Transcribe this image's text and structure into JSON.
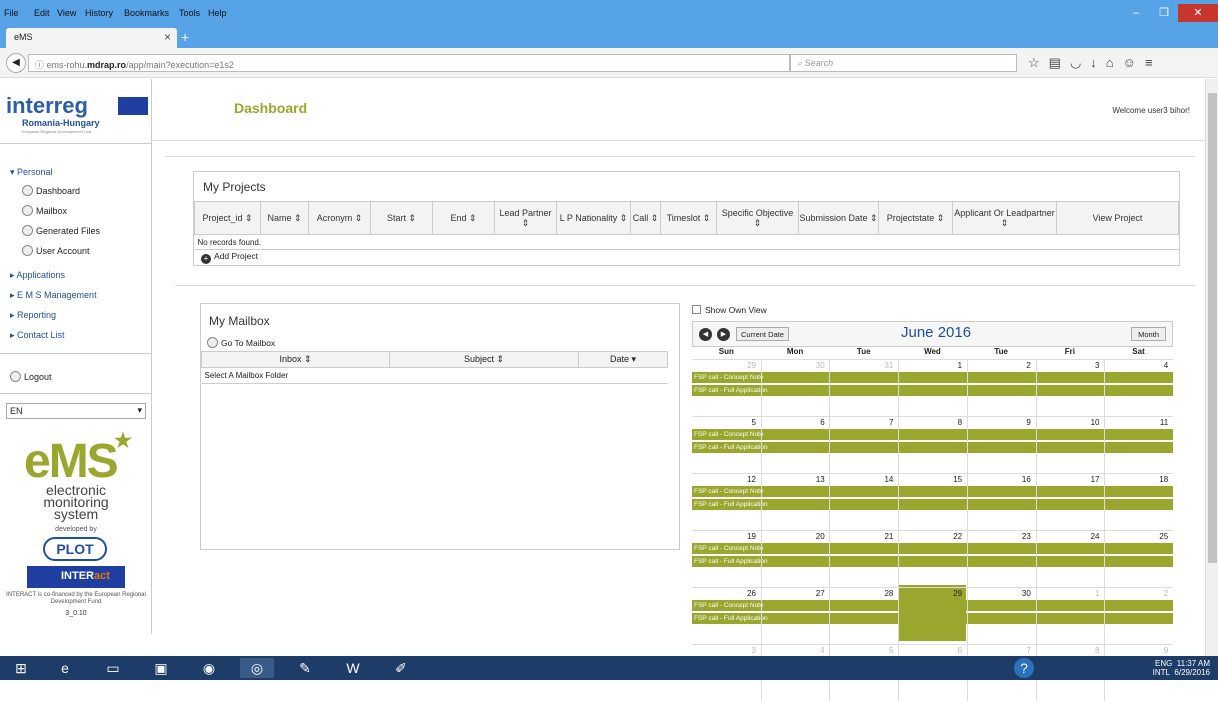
{
  "browser": {
    "menu": [
      "File",
      "Edit",
      "View",
      "History",
      "Bookmarks",
      "Tools",
      "Help"
    ],
    "tab_title": "eMS",
    "url_prefix": "ems-rohu.",
    "url_domain": "mdrap.ro",
    "url_path": "/app/main?execution=e1s2",
    "search_placeholder": "Search"
  },
  "sidebar": {
    "brand": "interreg",
    "brand_sub": "Romania-Hungary",
    "brand_sub2": "European Regional Development Fund",
    "personal": "Personal",
    "personal_items": [
      "Dashboard",
      "Mailbox",
      "Generated Files",
      "User Account"
    ],
    "sections": [
      "Applications",
      "E M S Management",
      "Reporting",
      "Contact List"
    ],
    "logout": "Logout",
    "language": "EN",
    "ems_logo": "eMS",
    "ems_lines": [
      "electronic",
      "monitoring",
      "system"
    ],
    "developed_by": "developed by",
    "plot": "PLOT",
    "interact_a": "INTER",
    "interact_b": "act",
    "cofinanced": "INTERACT is co-financed by the European Regional Development Fund",
    "version": "3_0.10"
  },
  "header": {
    "title": "Dashboard",
    "welcome": "Welcome user3 bihor!"
  },
  "projects": {
    "title": "My Projects",
    "columns": [
      "Project_id ⇕",
      "Name ⇕",
      "Acronym ⇕",
      "Start ⇕",
      "End ⇕",
      "Lead Partner ⇕",
      "L P Nationality ⇕",
      "Call ⇕",
      "Timeslot ⇕",
      "Specific Objective ⇕",
      "Submission Date ⇕",
      "Projectstate ⇕",
      "Applicant Or Leadpartner ⇕",
      "View Project"
    ],
    "empty": "No records found.",
    "add": "Add Project"
  },
  "mailbox": {
    "title": "My Mailbox",
    "goto": "Go To Mailbox",
    "columns": [
      "Inbox ⇕",
      "Subject ⇕",
      "Date ▾"
    ],
    "row": "Select A Mailbox Folder"
  },
  "calendar": {
    "own_view": "Show Own View",
    "current_date": "Current Date",
    "title": "June 2016",
    "month_button": "Month",
    "dow": [
      "Sun",
      "Mon",
      "Tue",
      "Wed",
      "Tue",
      "Fri",
      "Sat"
    ],
    "weeks": [
      [
        "29",
        "30",
        "31",
        "1",
        "2",
        "3",
        "4"
      ],
      [
        "5",
        "6",
        "7",
        "8",
        "9",
        "10",
        "11"
      ],
      [
        "12",
        "13",
        "14",
        "15",
        "16",
        "17",
        "18"
      ],
      [
        "19",
        "20",
        "21",
        "22",
        "23",
        "24",
        "25"
      ],
      [
        "26",
        "27",
        "28",
        "29",
        "30",
        "1",
        "2"
      ],
      [
        "3",
        "4",
        "5",
        "6",
        "7",
        "8",
        "9"
      ]
    ],
    "event_a": "FSP call - Concept Note",
    "event_b": "FSP call - Full Application",
    "accent": "#9aa62d"
  },
  "taskbar": {
    "lang": "ENG",
    "lang2": "INTL",
    "time": "11:37 AM",
    "date": "6/29/2016"
  }
}
